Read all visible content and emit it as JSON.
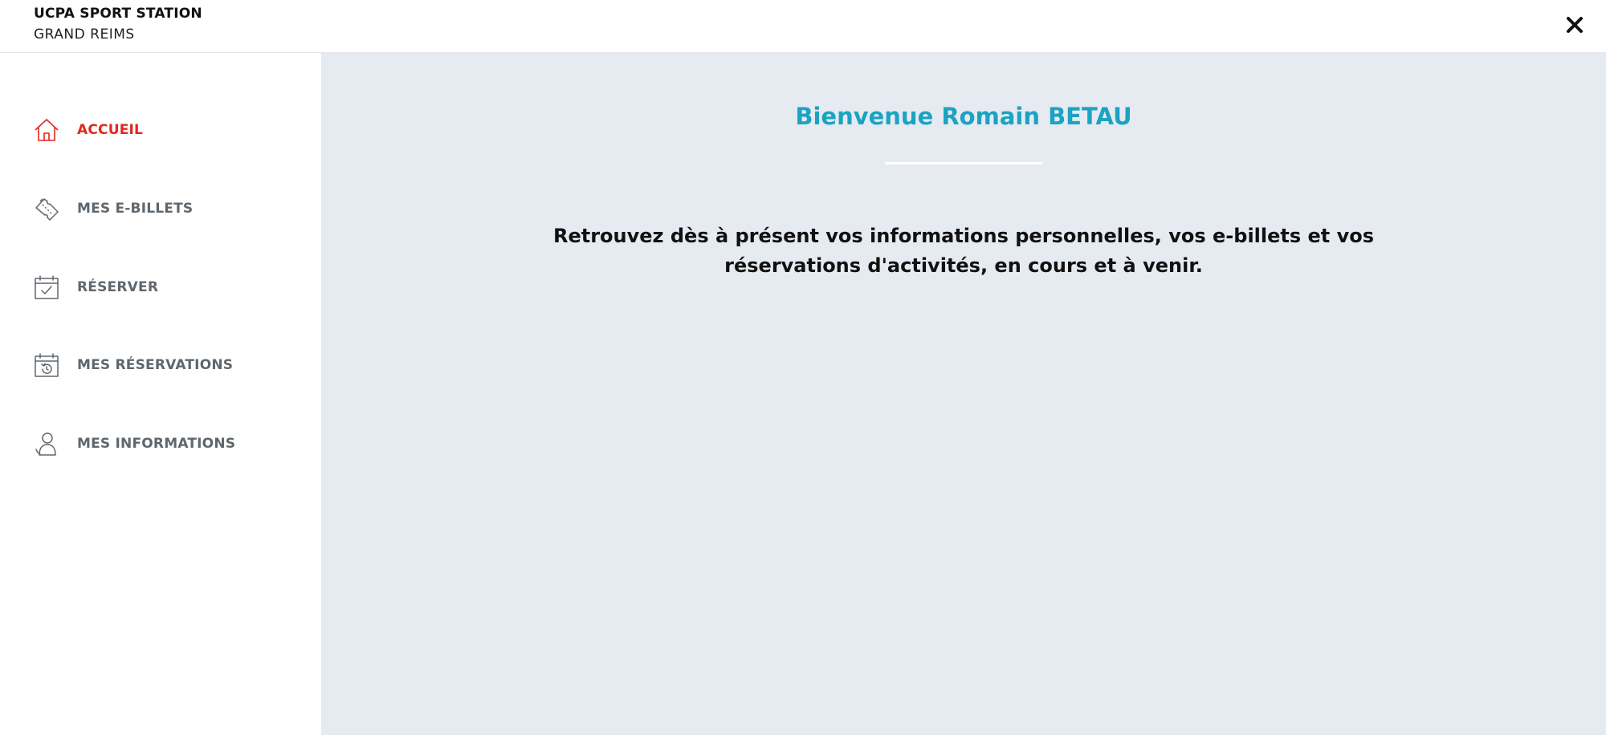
{
  "header": {
    "brand_title": "UCPA SPORT STATION",
    "brand_subtitle": "GRAND REIMS",
    "close_icon": "close-icon"
  },
  "sidebar": {
    "items": [
      {
        "label": "ACCUEIL",
        "icon": "home-icon",
        "active": true
      },
      {
        "label": "MES E-BILLETS",
        "icon": "ticket-icon",
        "active": false
      },
      {
        "label": "RÉSERVER",
        "icon": "calendar-check-icon",
        "active": false
      },
      {
        "label": "MES RÉSERVATIONS",
        "icon": "calendar-history-icon",
        "active": false
      },
      {
        "label": "MES INFORMATIONS",
        "icon": "user-icon",
        "active": false
      }
    ]
  },
  "main": {
    "welcome": "Bienvenue Romain BETAU",
    "intro": "Retrouvez dès à présent vos informations personnelles, vos e-billets et vos réservations d'activités, en cours et à venir."
  },
  "colors": {
    "accent_active": "#e1261c",
    "welcome_title": "#1ba3c3",
    "nav_text": "#5f676d",
    "main_background": "#e6eaf1"
  }
}
